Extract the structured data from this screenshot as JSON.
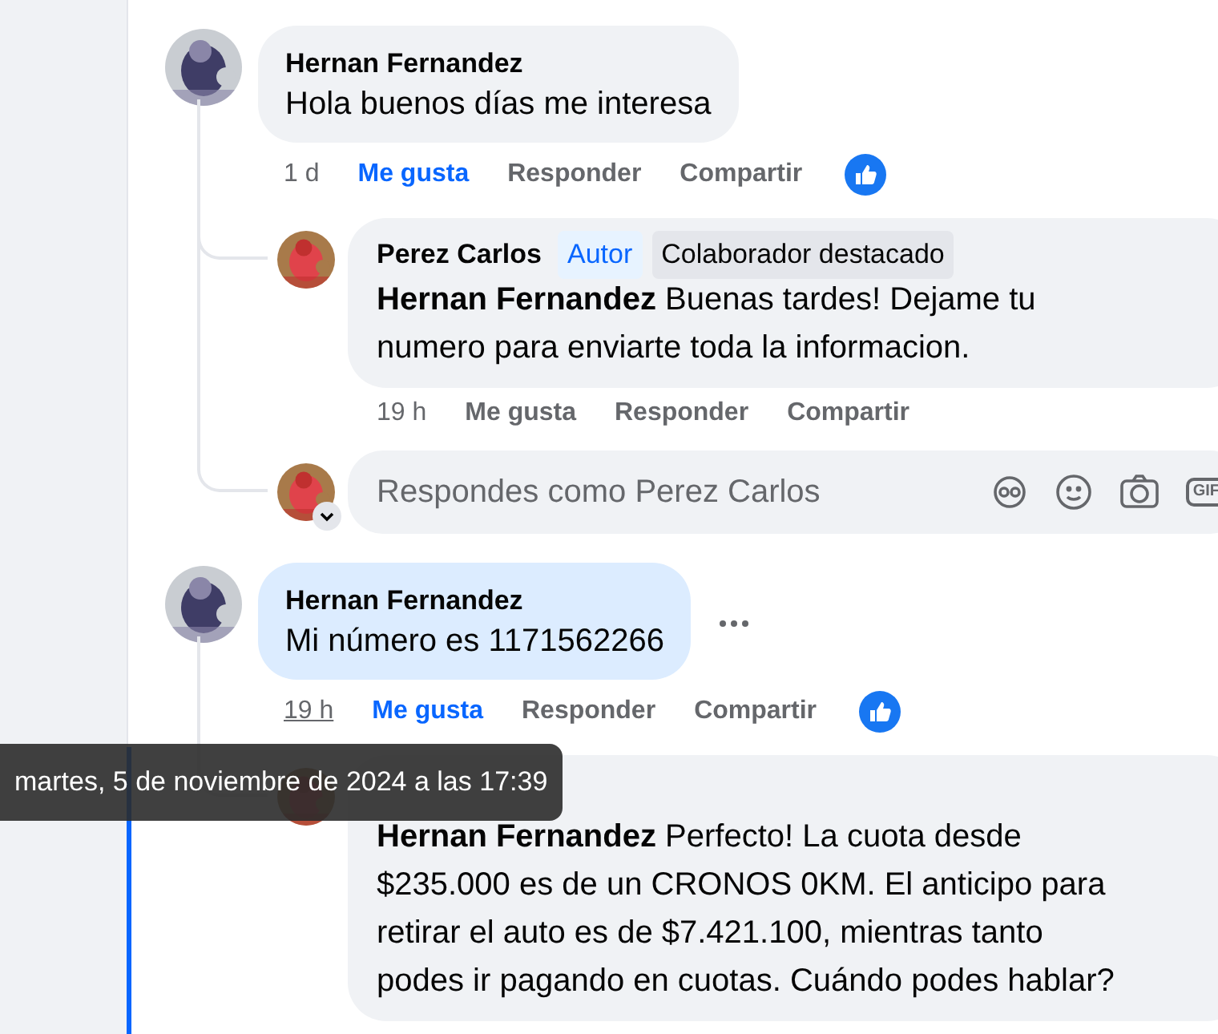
{
  "comments": [
    {
      "author": "Hernan Fernandez",
      "text": "Hola buenos días me interesa",
      "highlighted": false,
      "more_menu": false,
      "time": "1 d",
      "time_hovered": false,
      "like_label": "Me gusta",
      "liked": true,
      "reply_label": "Responder",
      "share_label": "Compartir",
      "reactions": true,
      "replies": [
        {
          "author": "Perez Carlos",
          "badges": [
            {
              "label": "Autor",
              "kind": "author"
            },
            {
              "label": "Colaborador destacado",
              "kind": "top"
            }
          ],
          "text": "**Hernan Fernandez** Buenas tardes! Dejame tu numero para enviarte toda la informacion.",
          "actions": {
            "time": "19 h",
            "like_label": "Me gusta",
            "liked": false,
            "reply_label": "Responder",
            "share_label": "Compartir"
          }
        }
      ],
      "reply_box": {
        "placeholder": "Respondes como Perez Carlos",
        "gif_label": "GIF"
      }
    },
    {
      "author": "Hernan Fernandez",
      "text": "Mi número es 1171562266",
      "highlighted": true,
      "more_menu": true,
      "time": "19 h",
      "time_hovered": true,
      "like_label": "Me gusta",
      "liked": true,
      "reply_label": "Responder",
      "share_label": "Compartir",
      "reactions": true,
      "replies": [
        {
          "text": "**Hernan Fernandez** Perfecto! La cuota desde $235.000 es de un CRONOS 0KM. El anticipo para retirar el auto es de $7.421.100, mientras tanto podes ir pagando en cuotas. Cuándo podes hablar?"
        }
      ]
    }
  ],
  "tooltip": "martes, 5 de noviembre de 2024 a las 17:39"
}
